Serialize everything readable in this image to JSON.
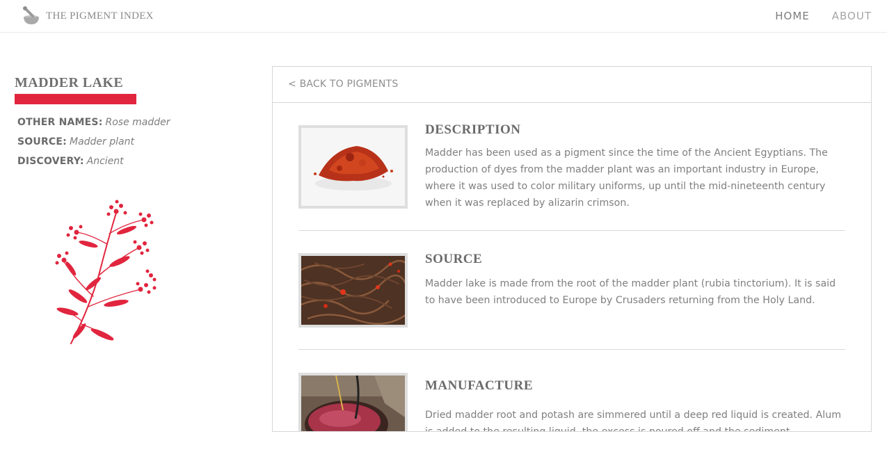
{
  "header": {
    "brand": "THE PIGMENT INDEX",
    "brand_icon": "mortar-pestle-icon",
    "nav": {
      "home": "HOME",
      "about": "ABOUT"
    }
  },
  "pigment": {
    "name": "MADDER LAKE",
    "accent_color": "#e1253e",
    "meta": [
      {
        "key": "OTHER NAMES:",
        "value": "Rose madder"
      },
      {
        "key": "SOURCE:",
        "value": "Madder plant"
      },
      {
        "key": "DISCOVERY:",
        "value": "Ancient"
      }
    ],
    "illustration": "madder-plant-illustration"
  },
  "panel": {
    "back_label": "< BACK TO PIGMENTS",
    "sections": [
      {
        "title": "DESCRIPTION",
        "image": "red-pigment-powder",
        "text": "Madder has been used as a pigment since the time of the Ancient Egyptians. The production of dyes from the madder plant was an important industry in Europe, where it was used to color military uniforms, up until the mid-nineteenth century when it was replaced by alizarin crimson."
      },
      {
        "title": "SOURCE",
        "image": "madder-roots",
        "text": "Madder lake is made from the root of the madder plant (rubia tinctorium). It is said to have been introduced to Europe by Crusaders returning from the Holy Land."
      },
      {
        "title": "MANUFACTURE",
        "image": "dye-pot",
        "text": "Dried madder root and potash are simmered until a deep red liquid is created. Alum is added to the resulting liquid, the excess is poured off and the sediment"
      }
    ]
  }
}
